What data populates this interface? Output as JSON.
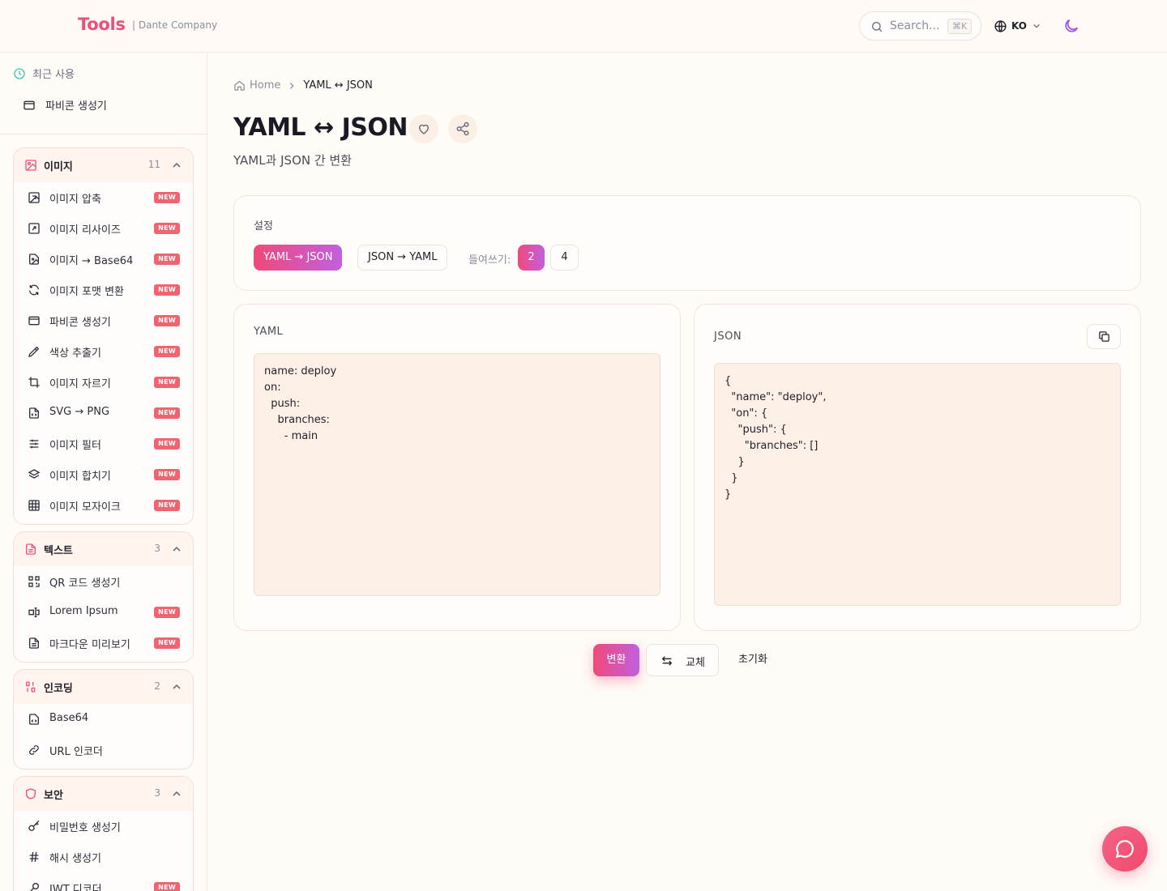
{
  "header": {
    "logo": "Tools",
    "company": "| Dante Company",
    "search_placeholder": "Search...",
    "search_shortcut": "⌘K",
    "language": "KO",
    "accent": "#ef4e7a"
  },
  "sidebar": {
    "recent_label": "최근 사용",
    "recent_items": [
      "파비콘 생성기"
    ],
    "groups": [
      {
        "label": "이미지",
        "count": "11",
        "items": [
          {
            "label": "이미지 압축",
            "badge": "NEW"
          },
          {
            "label": "이미지 리사이즈",
            "badge": "NEW"
          },
          {
            "label": "이미지 → Base64",
            "badge": "NEW"
          },
          {
            "label": "이미지 포맷 변환",
            "badge": "NEW"
          },
          {
            "label": "파비콘 생성기",
            "badge": "NEW"
          },
          {
            "label": "색상 추출기",
            "badge": "NEW"
          },
          {
            "label": "이미지 자르기",
            "badge": "NEW"
          },
          {
            "label": "SVG → PNG",
            "badge": "NEW"
          },
          {
            "label": "이미지 필터",
            "badge": "NEW"
          },
          {
            "label": "이미지 합치기",
            "badge": "NEW"
          },
          {
            "label": "이미지 모자이크",
            "badge": "NEW"
          }
        ]
      },
      {
        "label": "텍스트",
        "count": "3",
        "items": [
          {
            "label": "QR 코드 생성기",
            "badge": ""
          },
          {
            "label": "Lorem Ipsum",
            "badge": "NEW"
          },
          {
            "label": "마크다운 미리보기",
            "badge": "NEW"
          }
        ]
      },
      {
        "label": "인코딩",
        "count": "2",
        "items": [
          {
            "label": "Base64",
            "badge": ""
          },
          {
            "label": "URL 인코더",
            "badge": ""
          }
        ]
      },
      {
        "label": "보안",
        "count": "3",
        "items": [
          {
            "label": "비밀번호 생성기",
            "badge": ""
          },
          {
            "label": "해시 생성기",
            "badge": ""
          },
          {
            "label": "JWT 디코더",
            "badge": "NEW"
          }
        ]
      }
    ]
  },
  "main": {
    "breadcrumb": {
      "home": "Home",
      "current": "YAML ↔ JSON"
    },
    "title": "YAML ↔ JSON",
    "subtitle": "YAML과 JSON 간 변환",
    "settings": {
      "label": "설정",
      "mode_yaml_to_json": "YAML → JSON",
      "mode_json_to_yaml": "JSON → YAML",
      "indent_label": "들여쓰기:",
      "indent_2": "2",
      "indent_4": "4",
      "selected_mode": "YAML → JSON",
      "selected_indent": "2"
    },
    "yaml_pane": {
      "label": "YAML",
      "value": "name: deploy\non:\n  push:\n    branches:\n      - main"
    },
    "json_pane": {
      "label": "JSON",
      "value": "{\n  \"name\": \"deploy\",\n  \"on\": {\n    \"push\": {\n      \"branches\": []\n    }\n  }\n}"
    },
    "actions": {
      "convert": "변환",
      "swap": "교체",
      "reset": "초기화"
    }
  }
}
